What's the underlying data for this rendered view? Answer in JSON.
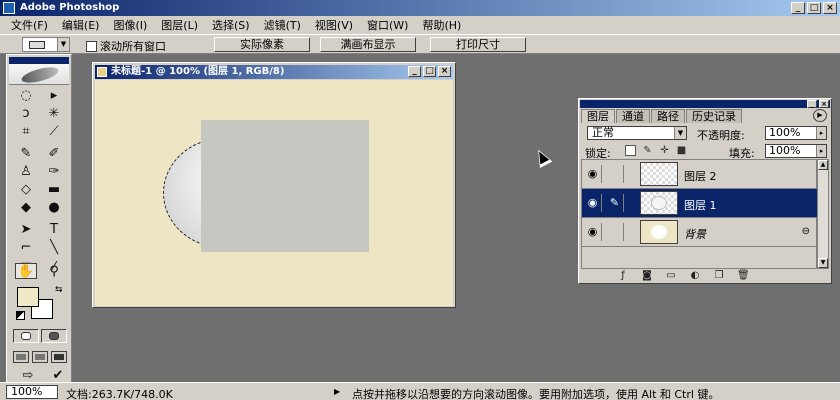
{
  "app": {
    "title": "Adobe Photoshop",
    "window_buttons": [
      "_",
      "□",
      "×"
    ]
  },
  "menu": [
    "文件(F)",
    "编辑(E)",
    "图像(I)",
    "图层(L)",
    "选择(S)",
    "滤镜(T)",
    "视图(V)",
    "窗口(W)",
    "帮助(H)"
  ],
  "options": {
    "scroll_all_label": "滚动所有窗口",
    "actual_pixels": "实际像素",
    "fit_on_screen": "满画布显示",
    "print_size": "打印尺寸"
  },
  "document": {
    "title": "未标题-1 @ 100% (图层 1, RGB/8)",
    "canvas_color": "#ede5c4",
    "buttons": [
      "_",
      "□",
      "×"
    ]
  },
  "toolbox": {
    "foreground_color": "#efe9c8",
    "background_color": "#ffffff"
  },
  "layers_panel": {
    "tabs": [
      "图层",
      "通道",
      "路径",
      "历史记录"
    ],
    "blend_mode": "正常",
    "opacity_label": "不透明度:",
    "opacity_value": "100%",
    "lock_label": "锁定:",
    "fill_label": "填充:",
    "fill_value": "100%",
    "layers": [
      {
        "name": "图层 2",
        "selected": false,
        "italic": false
      },
      {
        "name": "图层 1",
        "selected": true,
        "italic": false
      },
      {
        "name": "背景",
        "selected": false,
        "italic": true
      }
    ],
    "accent": "#0a246a"
  },
  "status": {
    "zoom": "100%",
    "doc_size": "文档:263.7K/748.0K",
    "hint": "点按并拖移以沿想要的方向滚动图像。要用附加选项，使用 Alt 和 Ctrl 键。"
  }
}
